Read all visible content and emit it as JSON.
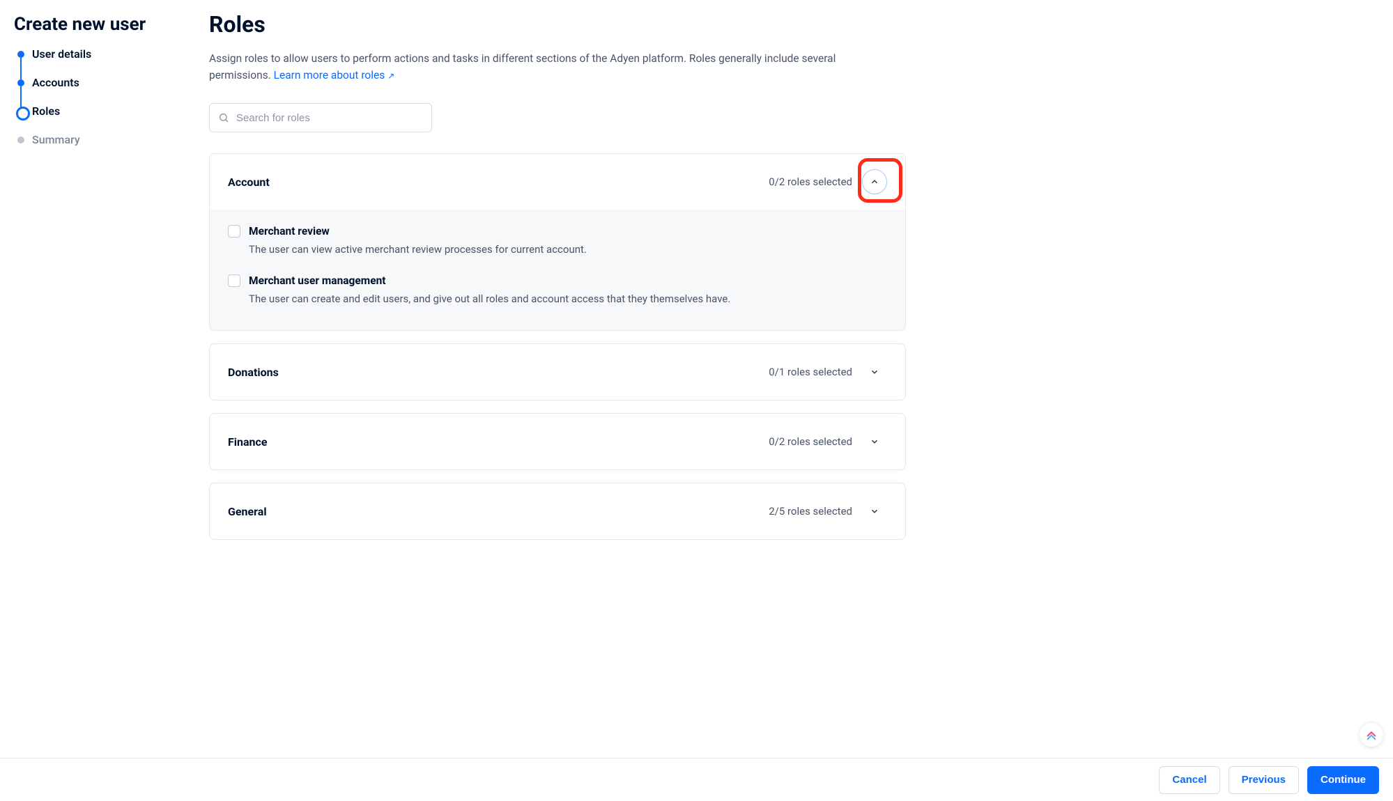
{
  "sidebar": {
    "title": "Create new user",
    "steps": [
      {
        "label": "User details",
        "state": "done"
      },
      {
        "label": "Accounts",
        "state": "done"
      },
      {
        "label": "Roles",
        "state": "current"
      },
      {
        "label": "Summary",
        "state": "pending"
      }
    ]
  },
  "main": {
    "title": "Roles",
    "description_prefix": "Assign roles to allow users to perform actions and tasks in different sections of the Adyen platform. Roles generally include several permissions. ",
    "learn_more_label": "Learn more about roles",
    "search_placeholder": "Search for roles"
  },
  "groups": [
    {
      "id": "account",
      "title": "Account",
      "count_label": "0/2 roles selected",
      "expanded": true,
      "toggleHighlighted": true,
      "roles": [
        {
          "name": "Merchant review",
          "desc": "The user can view active merchant review processes for current account."
        },
        {
          "name": "Merchant user management",
          "desc": "The user can create and edit users, and give out all roles and account access that they themselves have."
        }
      ]
    },
    {
      "id": "donations",
      "title": "Donations",
      "count_label": "0/1 roles selected",
      "expanded": false
    },
    {
      "id": "finance",
      "title": "Finance",
      "count_label": "0/2 roles selected",
      "expanded": false
    },
    {
      "id": "general",
      "title": "General",
      "count_label": "2/5 roles selected",
      "expanded": false
    }
  ],
  "footer": {
    "cancel": "Cancel",
    "previous": "Previous",
    "continue": "Continue"
  }
}
